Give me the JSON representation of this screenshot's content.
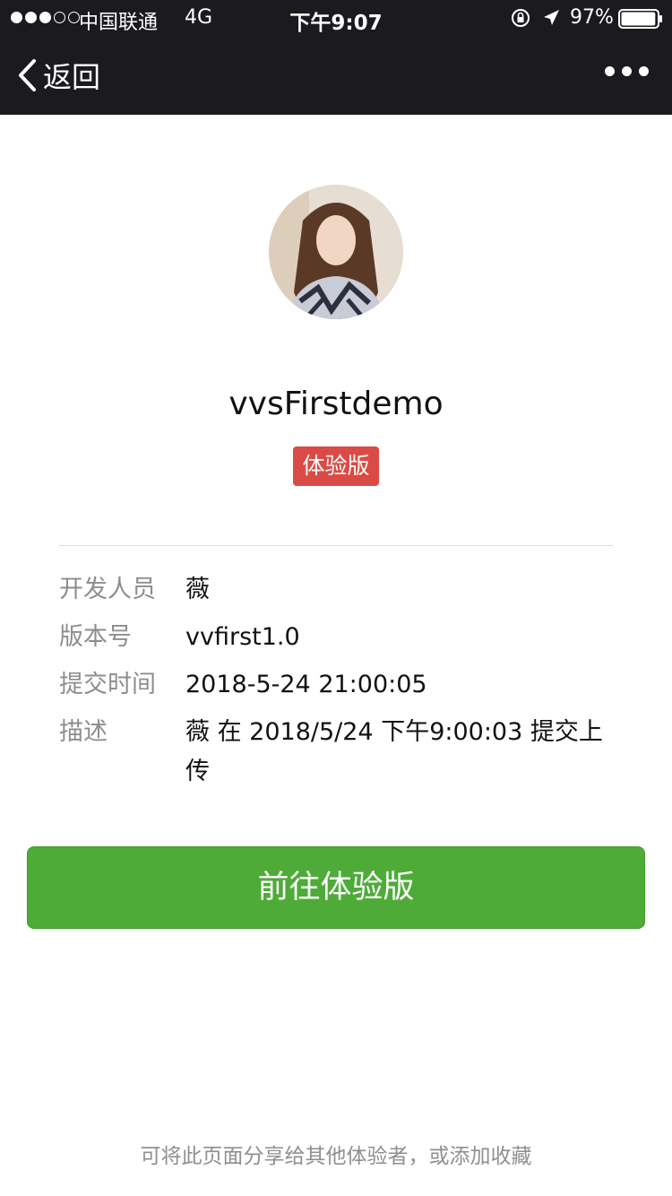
{
  "status_bar": {
    "carrier": "中国联通",
    "network": "4G",
    "time": "下午9:07",
    "battery": "97%",
    "battery_level": 0.97,
    "signal_bars_filled": 3,
    "signal_bars_total": 5
  },
  "nav": {
    "back_label": "返回",
    "more_icon": "more-dots-icon"
  },
  "app": {
    "name": "vvsFirstdemo",
    "badge": "体验版"
  },
  "info": [
    {
      "label": "开发人员",
      "value": "薇"
    },
    {
      "label": "版本号",
      "value": "vvfirst1.0"
    },
    {
      "label": "提交时间",
      "value": "2018-5-24 21:00:05"
    },
    {
      "label": "描述",
      "value": "薇 在 2018/5/24 下午9:00:03 提交上传"
    }
  ],
  "actions": {
    "primary": "前往体验版"
  },
  "footer": {
    "hint": "可将此页面分享给其他体验者，或添加收藏"
  },
  "colors": {
    "topbar_bg": "#1b1a1f",
    "badge_bg": "#db4b45",
    "primary_bg": "#4eab38"
  }
}
